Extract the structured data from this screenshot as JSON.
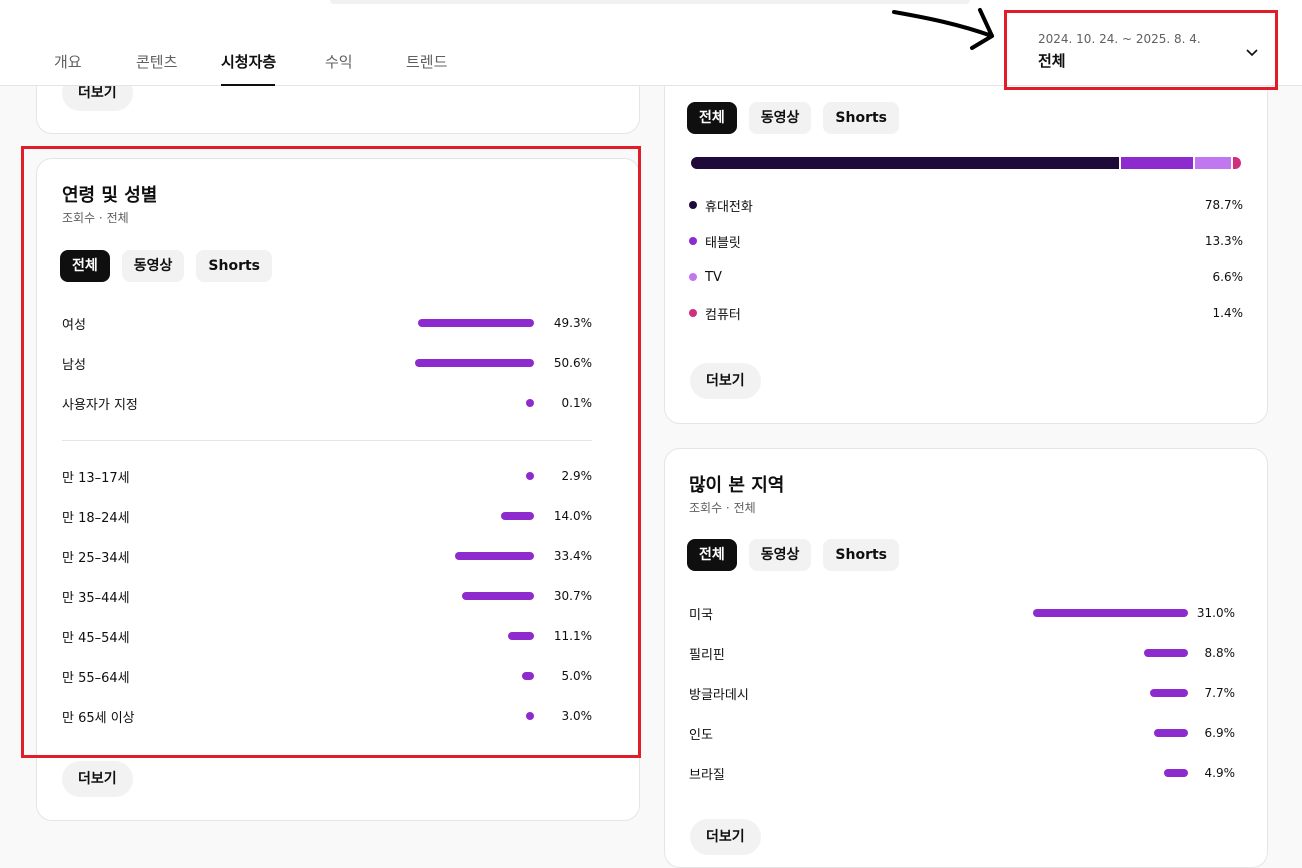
{
  "header": {
    "tabs": [
      {
        "label": "개요"
      },
      {
        "label": "콘텐츠"
      },
      {
        "label": "시청자층"
      },
      {
        "label": "수익"
      },
      {
        "label": "트렌드"
      }
    ],
    "active_tab": "시청자층",
    "date_range": "2024. 10. 24. ~ 2025. 8. 4.",
    "period_label": "전체"
  },
  "top_card": {
    "more_label": "더보기"
  },
  "age_gender": {
    "title": "연령 및 성별",
    "subtitle": "조회수 · 전체",
    "chips": [
      "전체",
      "동영상",
      "Shorts"
    ],
    "gender": [
      {
        "label": "여성",
        "value": 49.3,
        "display": "49.3%"
      },
      {
        "label": "남성",
        "value": 50.6,
        "display": "50.6%"
      },
      {
        "label": "사용자가 지정",
        "value": 0.1,
        "display": "0.1%"
      }
    ],
    "age": [
      {
        "label": "만 13–17세",
        "value": 2.9,
        "display": "2.9%"
      },
      {
        "label": "만 18–24세",
        "value": 14.0,
        "display": "14.0%"
      },
      {
        "label": "만 25–34세",
        "value": 33.4,
        "display": "33.4%"
      },
      {
        "label": "만 35–44세",
        "value": 30.7,
        "display": "30.7%"
      },
      {
        "label": "만 45–54세",
        "value": 11.1,
        "display": "11.1%"
      },
      {
        "label": "만 55–64세",
        "value": 5.0,
        "display": "5.0%"
      },
      {
        "label": "만 65세 이상",
        "value": 3.0,
        "display": "3.0%"
      }
    ],
    "more_label": "더보기"
  },
  "devices": {
    "chips": [
      "전체",
      "동영상",
      "Shorts"
    ],
    "items": [
      {
        "label": "휴대전화",
        "value": 78.7,
        "display": "78.7%",
        "color": "#1f0a3a"
      },
      {
        "label": "태블릿",
        "value": 13.3,
        "display": "13.3%",
        "color": "#8d2bcf"
      },
      {
        "label": "TV",
        "value": 6.6,
        "display": "6.6%",
        "color": "#c077f0"
      },
      {
        "label": "컴퓨터",
        "value": 1.4,
        "display": "1.4%",
        "color": "#d12e7c"
      }
    ],
    "more_label": "더보기"
  },
  "regions": {
    "title": "많이 본 지역",
    "subtitle": "조회수 · 전체",
    "chips": [
      "전체",
      "동영상",
      "Shorts"
    ],
    "items": [
      {
        "label": "미국",
        "value": 31.0,
        "display": "31.0%"
      },
      {
        "label": "필리핀",
        "value": 8.8,
        "display": "8.8%"
      },
      {
        "label": "방글라데시",
        "value": 7.7,
        "display": "7.7%"
      },
      {
        "label": "인도",
        "value": 6.9,
        "display": "6.9%"
      },
      {
        "label": "브라질",
        "value": 4.9,
        "display": "4.9%"
      }
    ],
    "more_label": "더보기"
  },
  "colors": {
    "bar": "#8d2bcf",
    "highlight": "#e11d2a",
    "ink": "#0f0f0f"
  },
  "icons": {
    "dropdown": "chevron-down-icon",
    "annotation": "arrow-annotation"
  }
}
